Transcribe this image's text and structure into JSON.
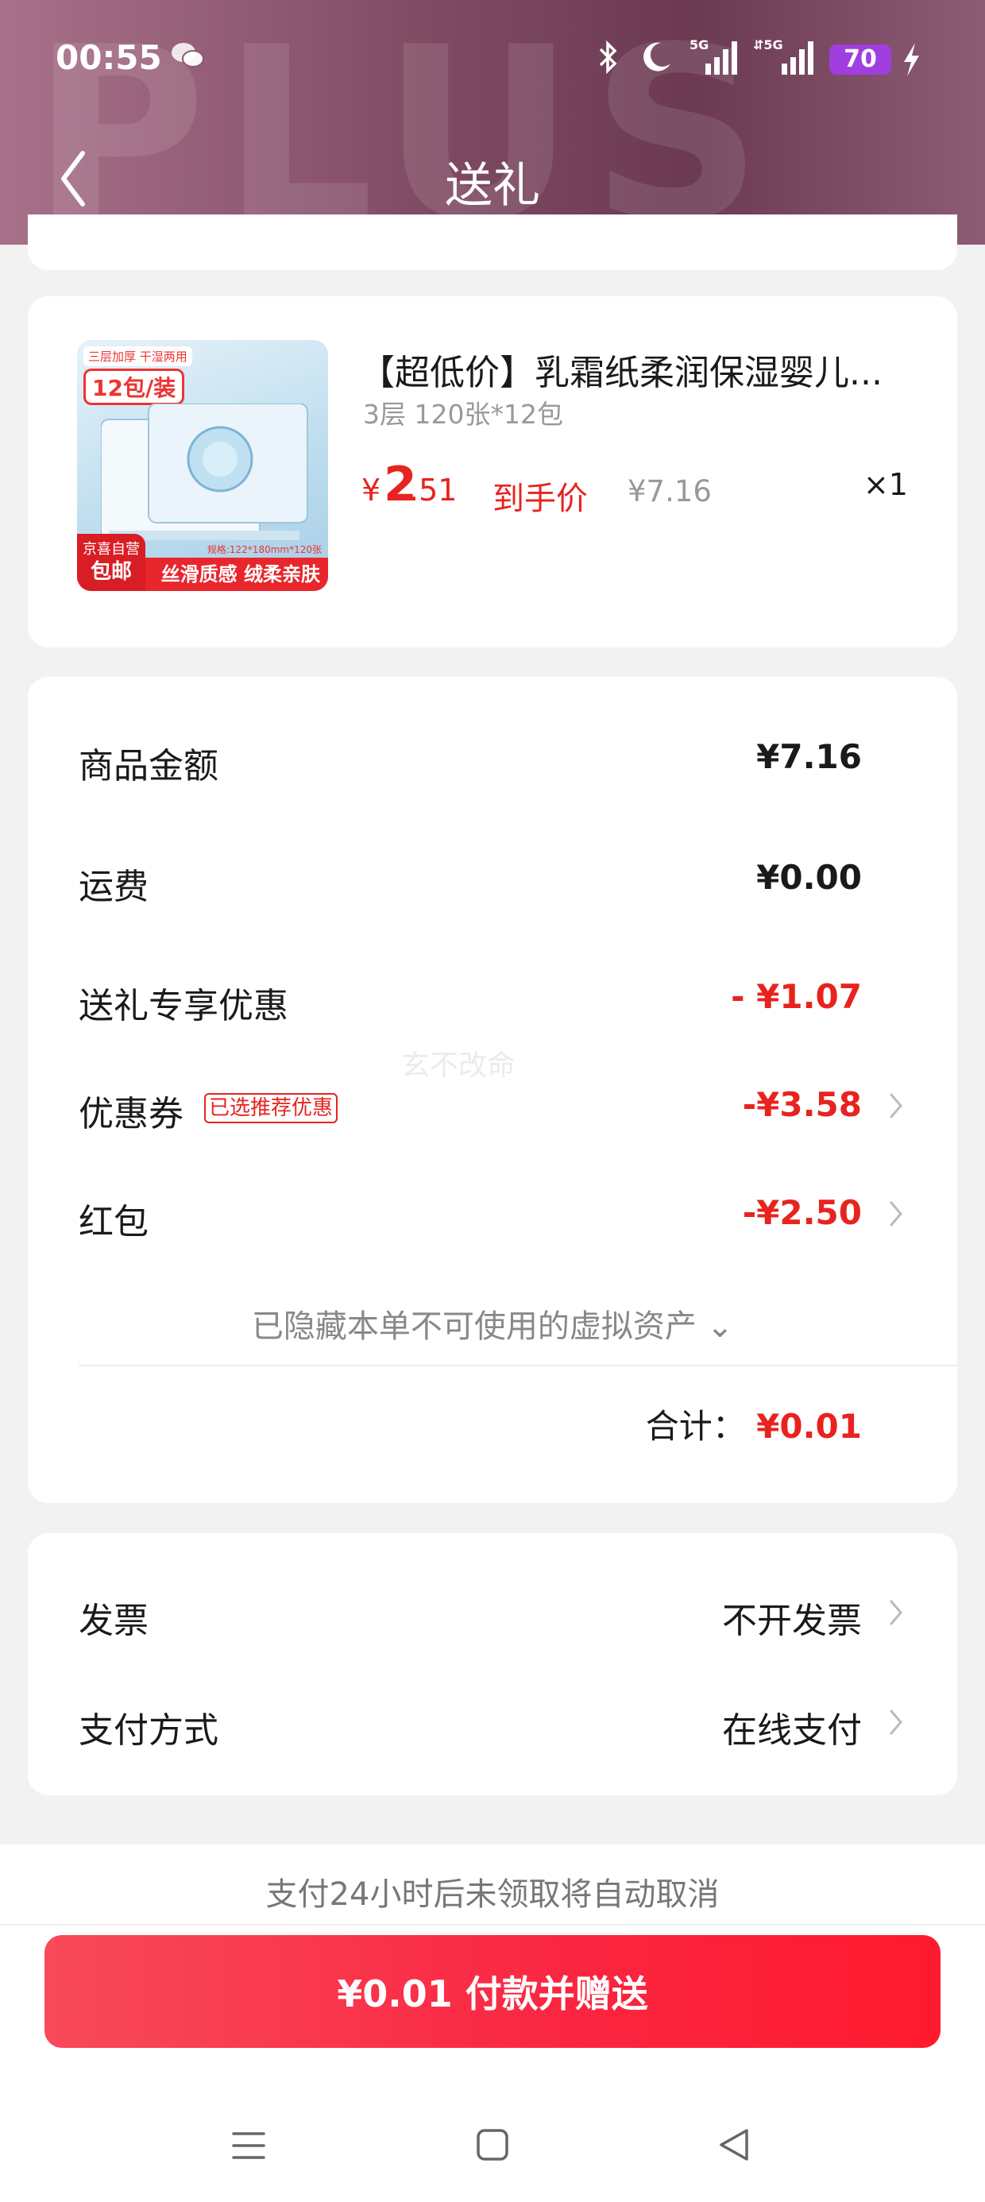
{
  "status_bar": {
    "time": "00:55",
    "battery": "70",
    "icons": [
      "wechat-icon",
      "bluetooth-icon",
      "moon-icon",
      "5g-signal-icon",
      "5g-signal-icon",
      "battery-icon",
      "charging-bolt-icon"
    ]
  },
  "header": {
    "title": "送礼",
    "watermark": "PLUS",
    "back_icon": "chevron-left-icon"
  },
  "product": {
    "title": "【超低价】乳霜纸柔润保湿婴儿...",
    "spec": "3层 120张*12包",
    "price_symbol": "¥",
    "price_int": "2",
    "price_dec": ".51",
    "price_label": "到手价",
    "original_price": "¥7.16",
    "quantity": "×1",
    "image": {
      "badge_top": "三层加厚 干湿两用",
      "badge_count": "12包/装",
      "spec_text": "规格:122*180mm*120张",
      "slogan": "丝滑质感 绒柔亲肤",
      "corner_top": "京喜自营",
      "corner_bottom": "包邮"
    }
  },
  "summary": {
    "rows": [
      {
        "label": "商品金额",
        "value": "¥7.16",
        "red": false
      },
      {
        "label": "运费",
        "value": "¥0.00",
        "red": false
      },
      {
        "label": "送礼专享优惠",
        "value": "- ¥1.07",
        "red": true
      },
      {
        "label": "优惠券",
        "tag": "已选推荐优惠",
        "value": "-¥3.58",
        "red": true
      },
      {
        "label": "红包",
        "value": "-¥2.50",
        "red": true
      }
    ],
    "hidden_assets": "已隐藏本单不可使用的虚拟资产 ⌄",
    "total_label": "合计：",
    "total_value": "¥0.01",
    "watermark": "玄不改命"
  },
  "invoice": {
    "invoice_label": "发票",
    "invoice_value": "不开发票",
    "payment_label": "支付方式",
    "payment_value": "在线支付"
  },
  "bottom": {
    "notice": "支付24小时后未领取将自动取消",
    "pay_button": "¥0.01 付款并赠送"
  },
  "colors": {
    "accent_red": "#e8231f",
    "header_gradient": [
      "#a8718a",
      "#6b3a52"
    ],
    "button_gradient": [
      "#f84a5a",
      "#ff1a2e"
    ]
  }
}
